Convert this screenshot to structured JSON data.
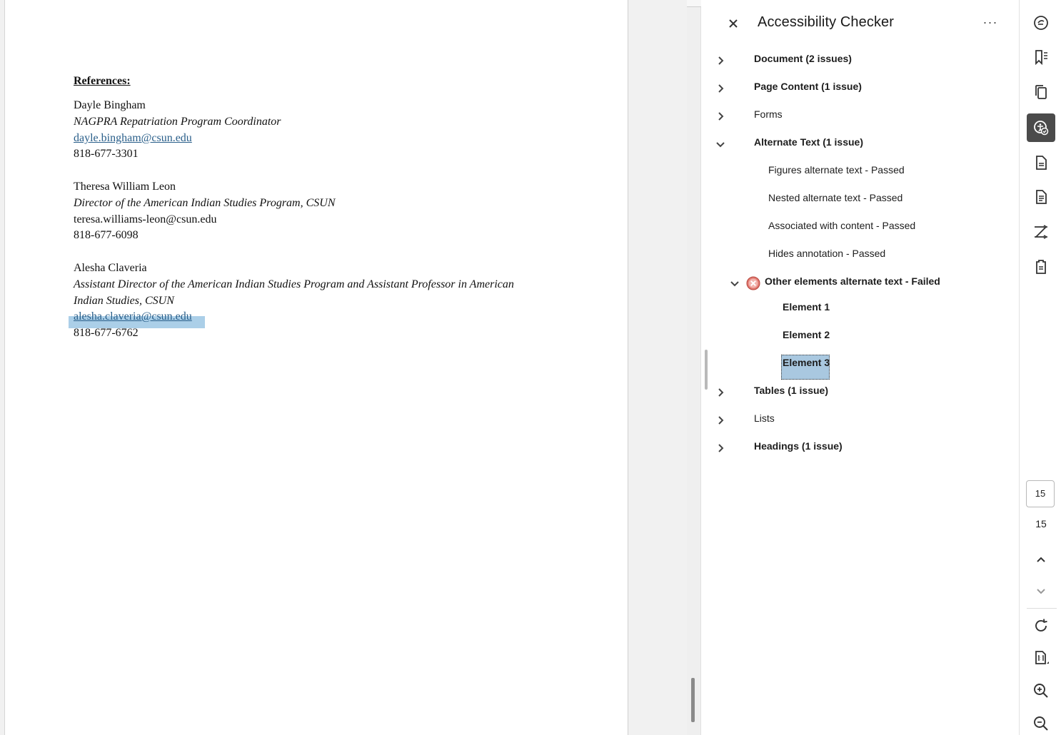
{
  "document": {
    "heading": "References:",
    "contacts": [
      {
        "name": "Dayle Bingham",
        "title": "NAGPRA Repatriation Program Coordinator",
        "email": "dayle.bingham@csun.edu",
        "phone": "818-677-3301"
      },
      {
        "name": "Theresa William Leon",
        "title": "Director of the American Indian Studies Program, CSUN",
        "email": "teresa.williams-leon@csun.edu",
        "phone": "818-677-6098"
      },
      {
        "name": "Alesha Claveria",
        "title_line1": "Assistant Director of the American Indian Studies Program and Assistant Professor in American",
        "title_line2": "Indian Studies, CSUN",
        "email": "alesha.claveria@csun.edu",
        "phone": "818-677-6762"
      }
    ]
  },
  "panel": {
    "title": "Accessibility Checker",
    "close_icon": "close-icon",
    "more_icon": "more-options-icon",
    "more_label": "···",
    "tree": {
      "document": "Document (2 issues)",
      "page_content": "Page Content (1 issue)",
      "forms": "Forms",
      "alternate_text": "Alternate Text (1 issue)",
      "figures_alt": "Figures alternate text - Passed",
      "nested_alt": "Nested alternate text - Passed",
      "associated": "Associated with content - Passed",
      "hides_annotation": "Hides annotation - Passed",
      "other_elements": "Other elements alternate text - Failed",
      "element1": "Element 1",
      "element2": "Element 2",
      "element3": "Element 3",
      "tables": "Tables (1 issue)",
      "lists": "Lists",
      "headings": "Headings (1 issue)"
    }
  },
  "rail": {
    "tools": [
      "comment-icon",
      "bookmarks-icon",
      "pages-icon",
      "accessibility-icon",
      "export-pdf-icon",
      "edit-pdf-icon",
      "compare-icon",
      "scan-icon"
    ],
    "page_current": "15",
    "page_total": "15",
    "nav": [
      "page-up-icon",
      "page-down-icon",
      "rotate-icon",
      "actual-size-icon",
      "zoom-in-icon",
      "zoom-out-icon"
    ]
  },
  "colors": {
    "accent_active": "#4b4b4b",
    "link": "#2a5f8a",
    "selection": "#a9c8e0",
    "error": "#d9534f"
  }
}
